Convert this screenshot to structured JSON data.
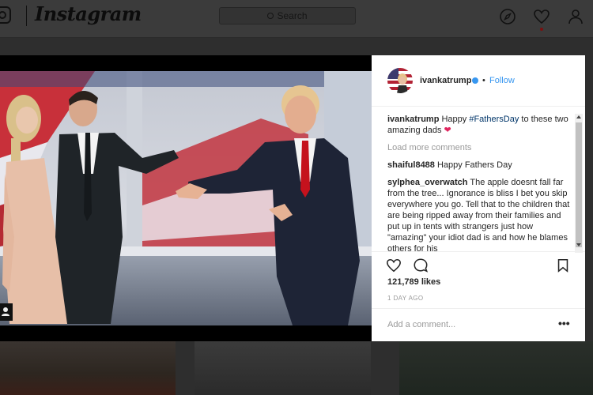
{
  "header": {
    "logo_text": "Instagram",
    "search_placeholder": "Search",
    "icons": [
      "camera-icon",
      "compass-icon",
      "heart-icon",
      "profile-icon"
    ]
  },
  "post": {
    "username": "ivankatrump",
    "verified": true,
    "separator": "•",
    "follow_label": "Follow",
    "caption": {
      "user": "ivankatrump",
      "text_before": "Happy ",
      "hashtag": "#FathersDay",
      "text_after": " to these two amazing dads ",
      "emoji": "❤"
    },
    "load_more_label": "Load more comments",
    "comments": [
      {
        "user": "shaiful8488",
        "text": "Happy Fathers Day"
      },
      {
        "user": "sylphea_overwatch",
        "text": "The apple doesnt fall far from the tree... Ignorance is bliss I bet you skip everywhere you go. Tell that to the children that are being ripped away from their families and put up in tents with strangers just how \"amazing\" your idiot dad is and how he blames others for his"
      }
    ],
    "likes_text": "121,789 likes",
    "time_ago": "1 DAY AGO",
    "add_comment_placeholder": "Add a comment...",
    "more_label": "•••",
    "header_more_label": "•••"
  },
  "colors": {
    "accent_blue": "#3897f0",
    "heart_red": "#e0245e",
    "hashtag_blue": "#003569"
  }
}
